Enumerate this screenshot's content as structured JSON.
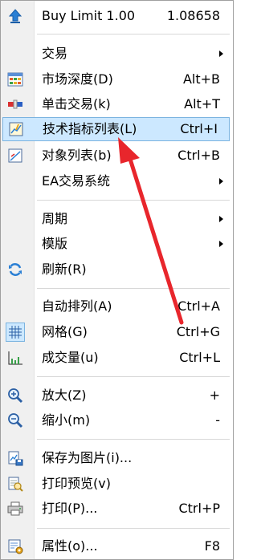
{
  "buy_limit": {
    "label": "Buy Limit 1.00",
    "price": "1.08658"
  },
  "menu": {
    "trading": "交易",
    "market_depth": {
      "label": "市场深度(D)",
      "shortcut": "Alt+B"
    },
    "one_click": {
      "label": "单击交易(k)",
      "shortcut": "Alt+T"
    },
    "indicators_list": {
      "label": "技术指标列表(L)",
      "shortcut": "Ctrl+I"
    },
    "objects_list": {
      "label": "对象列表(b)",
      "shortcut": "Ctrl+B"
    },
    "ea_system": "EA交易系统",
    "timeframes": "周期",
    "templates": "模版",
    "refresh": "刷新(R)",
    "auto_scroll": {
      "label": "自动排列(A)",
      "shortcut": "Ctrl+A"
    },
    "grid": {
      "label": "网格(G)",
      "shortcut": "Ctrl+G"
    },
    "volumes": {
      "label": "成交量(u)",
      "shortcut": "Ctrl+L"
    },
    "zoom_in": {
      "label": "放大(Z)",
      "shortcut": "+"
    },
    "zoom_out": {
      "label": "缩小(m)",
      "shortcut": "-"
    },
    "save_picture": "保存为图片(i)...",
    "print_preview": "打印预览(v)",
    "print": {
      "label": "打印(P)...",
      "shortcut": "Ctrl+P"
    },
    "properties": {
      "label": "属性(o)...",
      "shortcut": "F8"
    }
  },
  "colors": {
    "highlight_bg": "#cce8ff",
    "highlight_border": "#7ab3e0",
    "annotation_arrow": "#e8262c"
  },
  "icons": {
    "buy_limit": "up-arrow-icon",
    "market_depth": "grid-table-icon",
    "one_click": "trade-slider-icon",
    "indicators_list": "indicator-chart-icon",
    "objects_list": "objects-chart-icon",
    "refresh": "refresh-icon",
    "grid": "grid-icon",
    "volumes": "volumes-icon",
    "zoom_in": "zoom-in-icon",
    "zoom_out": "zoom-out-icon",
    "save_picture": "save-picture-icon",
    "print_preview": "print-preview-icon",
    "print": "printer-icon",
    "properties": "properties-icon"
  }
}
